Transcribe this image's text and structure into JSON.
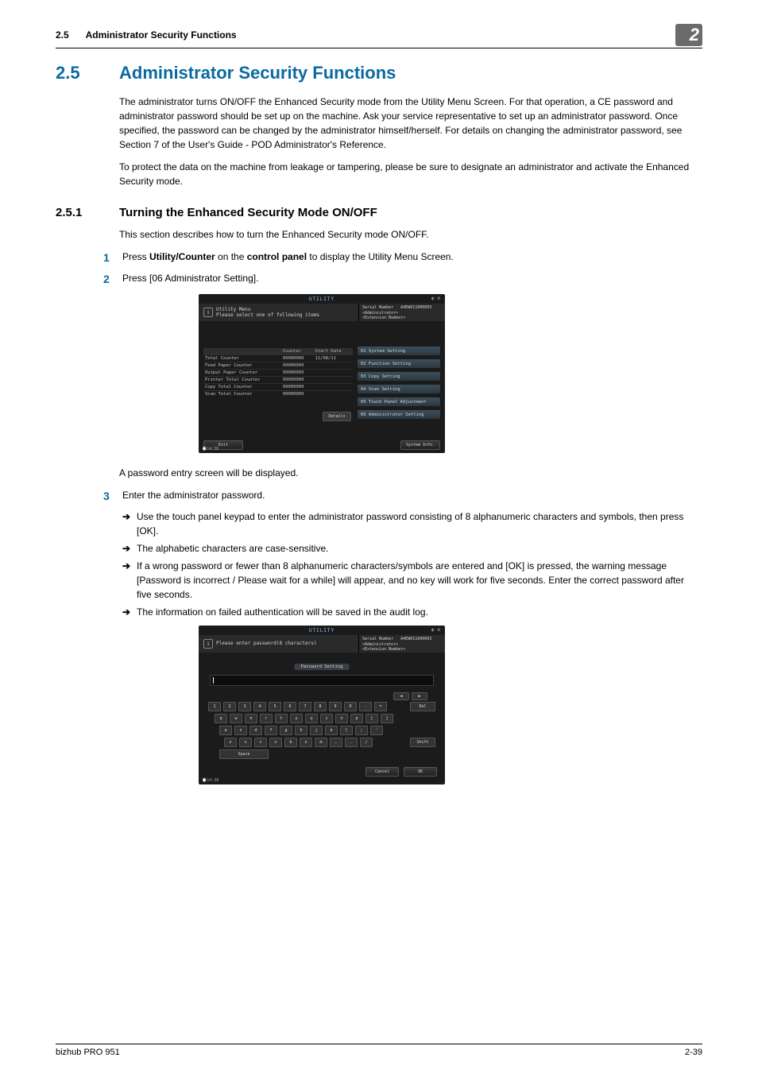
{
  "header": {
    "section_num": "2.5",
    "section_title": "Administrator Security Functions",
    "chapter_badge": "2"
  },
  "h2": {
    "num": "2.5",
    "title": "Administrator Security Functions"
  },
  "intro": {
    "p1": "The administrator turns ON/OFF the Enhanced Security mode from the Utility Menu Screen. For that operation, a CE password and administrator password should be set up on the machine. Ask your service representative to set up an administrator password. Once specified, the password can be changed by the administrator himself/herself. For details on changing the administrator password, see Section 7 of the User's Guide - POD Administrator's Reference.",
    "p2": "To protect the data on the machine from leakage or tampering, please be sure to designate an administrator and activate the Enhanced Security mode."
  },
  "h3": {
    "num": "2.5.1",
    "title": "Turning the Enhanced Security Mode ON/OFF"
  },
  "h3_intro": "This section describes how to turn the Enhanced Security mode ON/OFF.",
  "steps": {
    "s1_pre": "Press ",
    "s1_b1": "Utility/Counter",
    "s1_mid": " on the ",
    "s1_b2": "control panel",
    "s1_post": " to display the Utility Menu Screen.",
    "s2": "Press [06 Administrator Setting].",
    "after_shot1": "A password entry screen will be displayed.",
    "s3": "Enter the administrator password."
  },
  "bullets": {
    "b1": "Use the touch panel keypad to enter the administrator password consisting of 8 alphanumeric characters and symbols, then press [OK].",
    "b2": "The alphabetic characters are case-sensitive.",
    "b3": "If a wrong password or fewer than 8 alphanumeric characters/symbols are entered and [OK] is pressed, the warning message [Password is incorrect / Please wait for a while] will appear, and no key will work for five seconds. Enter the correct password after five seconds.",
    "b4": "The information on failed authentication will be saved in the audit log.",
    "arrow": "➔"
  },
  "shot_common": {
    "utility": "UTILITY",
    "serial": "Serial Number   A4EW011000003",
    "admin": "<Administrator>",
    "ext": "<Extension Number>",
    "time": "14:38",
    "exit": "Exit"
  },
  "shot1": {
    "info_line1": "Utility Menu",
    "info_line2": "Please select one of following items",
    "th_counter": "Counter",
    "th_start": "Start Date",
    "rows": [
      {
        "name": "Total Counter",
        "val": "00000000",
        "date": "11/08/11"
      },
      {
        "name": "Feed Paper Counter",
        "val": "00000000",
        "date": ""
      },
      {
        "name": "Output Paper Counter",
        "val": "00000000",
        "date": ""
      },
      {
        "name": "Printer Total Counter",
        "val": "00000000",
        "date": ""
      },
      {
        "name": "Copy Total Counter",
        "val": "00000000",
        "date": ""
      },
      {
        "name": "Scan Total Counter",
        "val": "00000000",
        "date": ""
      }
    ],
    "details": "Details",
    "menu": [
      "01 System Setting",
      "02 Function Setting",
      "03 Copy Setting",
      "04 Scan Setting",
      "05 Touch Panel Adjustment",
      "06 Administrator Setting"
    ],
    "sysinfo": "System Info."
  },
  "shot2": {
    "info": "Please enter password(8 characters)",
    "pw_title": "Password Setting",
    "del": "Del",
    "shift": "Shift",
    "space": "Space",
    "left": "◀",
    "right": "▶",
    "row1": [
      "1",
      "2",
      "3",
      "4",
      "5",
      "6",
      "7",
      "8",
      "9",
      "0",
      "-",
      "="
    ],
    "row2": [
      "q",
      "w",
      "e",
      "r",
      "t",
      "y",
      "u",
      "i",
      "o",
      "p",
      "[",
      "]"
    ],
    "row3": [
      "a",
      "s",
      "d",
      "f",
      "g",
      "h",
      "j",
      "k",
      "l",
      ";",
      "'"
    ],
    "row4": [
      "z",
      "x",
      "c",
      "v",
      "b",
      "n",
      "m",
      ",",
      ".",
      "/"
    ],
    "cancel": "Cancel",
    "ok": "OK"
  },
  "footer": {
    "left": "bizhub PRO 951",
    "right": "2-39"
  }
}
